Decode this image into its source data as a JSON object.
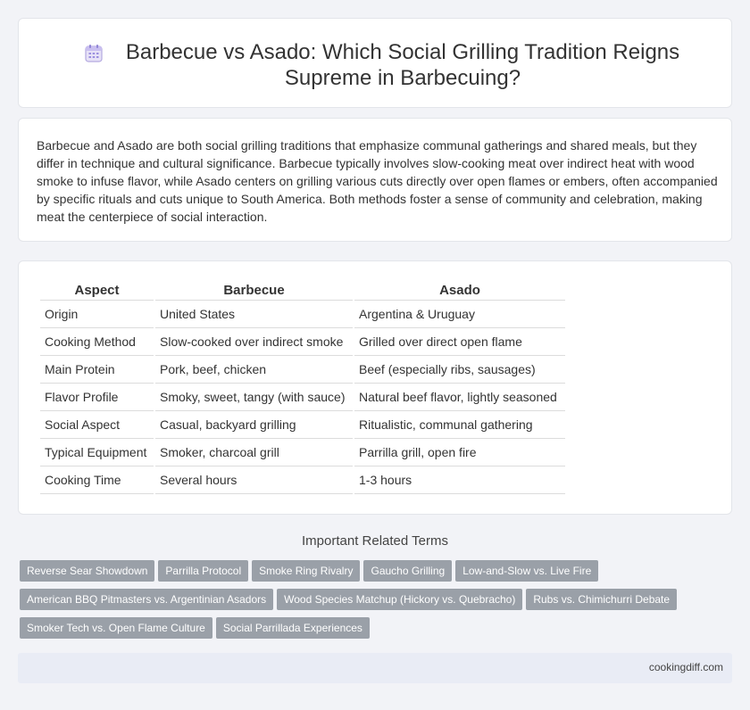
{
  "header": {
    "title": "Barbecue vs Asado: Which Social Grilling Tradition Reigns Supreme in Barbecuing?",
    "icon": "calendar-icon"
  },
  "intro": {
    "text": "Barbecue and Asado are both social grilling traditions that emphasize communal gatherings and shared meals, but they differ in technique and cultural significance. Barbecue typically involves slow-cooking meat over indirect heat with wood smoke to infuse flavor, while Asado centers on grilling various cuts directly over open flames or embers, often accompanied by specific rituals and cuts unique to South America. Both methods foster a sense of community and celebration, making meat the centerpiece of social interaction."
  },
  "table": {
    "headers": [
      "Aspect",
      "Barbecue",
      "Asado"
    ],
    "rows": [
      [
        "Origin",
        "United States",
        "Argentina & Uruguay"
      ],
      [
        "Cooking Method",
        "Slow-cooked over indirect smoke",
        "Grilled over direct open flame"
      ],
      [
        "Main Protein",
        "Pork, beef, chicken",
        "Beef (especially ribs, sausages)"
      ],
      [
        "Flavor Profile",
        "Smoky, sweet, tangy (with sauce)",
        "Natural beef flavor, lightly seasoned"
      ],
      [
        "Social Aspect",
        "Casual, backyard grilling",
        "Ritualistic, communal gathering"
      ],
      [
        "Typical Equipment",
        "Smoker, charcoal grill",
        "Parrilla grill, open fire"
      ],
      [
        "Cooking Time",
        "Several hours",
        "1-3 hours"
      ]
    ]
  },
  "related": {
    "title": "Important Related Terms",
    "tags": [
      "Reverse Sear Showdown",
      "Parrilla Protocol",
      "Smoke Ring Rivalry",
      "Gaucho Grilling",
      "Low-and-Slow vs. Live Fire",
      "American BBQ Pitmasters vs. Argentinian Asadors",
      "Wood Species Matchup (Hickory vs. Quebracho)",
      "Rubs vs. Chimichurri Debate",
      "Smoker Tech vs. Open Flame Culture",
      "Social Parrillada Experiences"
    ]
  },
  "footer": {
    "site": "cookingdiff.com"
  },
  "colors": {
    "background": "#f2f3f7",
    "tag": "#9aa0a8",
    "footer": "#e9ecf5"
  }
}
